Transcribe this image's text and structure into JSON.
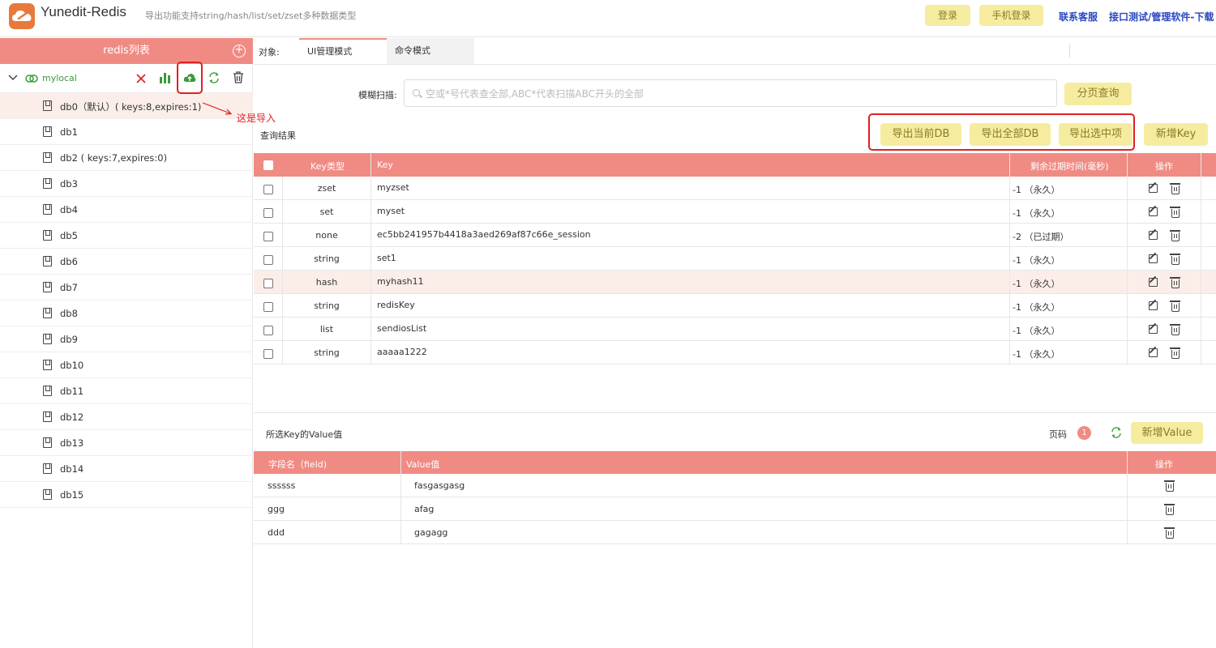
{
  "header": {
    "app_title": "Yunedit-Redis",
    "subtitle": "导出功能支持string/hash/list/set/zset多种数据类型",
    "login_label": "登录",
    "phone_login_label": "手机登录",
    "support_link": "联系客服",
    "download_link": "接口测试/管理软件-下载"
  },
  "sidebar": {
    "title": "redis列表",
    "connection": {
      "name": "mylocal"
    },
    "annotation": "这是导入",
    "databases": [
      {
        "label": "db0（默认）( keys:8,expires:1)"
      },
      {
        "label": "db1"
      },
      {
        "label": "db2 ( keys:7,expires:0)"
      },
      {
        "label": "db3"
      },
      {
        "label": "db4"
      },
      {
        "label": "db5"
      },
      {
        "label": "db6"
      },
      {
        "label": "db7"
      },
      {
        "label": "db8"
      },
      {
        "label": "db9"
      },
      {
        "label": "db10"
      },
      {
        "label": "db11"
      },
      {
        "label": "db12"
      },
      {
        "label": "db13"
      },
      {
        "label": "db14"
      },
      {
        "label": "db15"
      }
    ]
  },
  "main": {
    "object_label": "对象:",
    "tabs": [
      {
        "label": "UI管理模式"
      },
      {
        "label": "命令模式"
      }
    ],
    "scan_label": "模糊扫描:",
    "scan_placeholder": "空或*号代表查全部,ABC*代表扫描ABC开头的全部",
    "paged_query_label": "分页查询",
    "results_label": "查询结果",
    "export_current_label": "导出当前DB",
    "export_all_label": "导出全部DB",
    "export_selected_label": "导出选中项",
    "add_key_label": "新增Key",
    "key_table": {
      "headers": {
        "type": "Key类型",
        "key": "Key",
        "ttl": "剩余过期时间(毫秒)",
        "ops": "操作"
      },
      "rows": [
        {
          "type": "zset",
          "key": "myzset",
          "ttl": "-1 （永久）"
        },
        {
          "type": "set",
          "key": "myset",
          "ttl": "-1 （永久）"
        },
        {
          "type": "none",
          "key": "ec5bb241957b4418a3aed269af87c66e_session",
          "ttl": "-2 （已过期）"
        },
        {
          "type": "string",
          "key": "set1",
          "ttl": "-1 （永久）"
        },
        {
          "type": "hash",
          "key": "myhash11",
          "ttl": "-1 （永久）"
        },
        {
          "type": "string",
          "key": "redisKey",
          "ttl": "-1 （永久）"
        },
        {
          "type": "list",
          "key": "sendiosList",
          "ttl": "-1 （永久）"
        },
        {
          "type": "string",
          "key": "aaaaa1222",
          "ttl": "-1 （永久）"
        }
      ]
    },
    "value_section": {
      "title": "所选Key的Value值",
      "page_label": "页码",
      "page_number": "1",
      "add_value_label": "新增Value",
      "headers": {
        "field": "字段名（field)",
        "value": "Value值",
        "ops": "操作"
      },
      "rows": [
        {
          "field": "ssssss",
          "value": "fasgasgasg"
        },
        {
          "field": "ggg",
          "value": "afag"
        },
        {
          "field": "ddd",
          "value": "gagagg"
        }
      ]
    }
  },
  "colors": {
    "accent": "#f08b84",
    "button_yellow": "#f6eca0",
    "highlight_frame": "#e02020",
    "link_blue": "#2b48c2",
    "row_highlight": "#fbeee9"
  }
}
